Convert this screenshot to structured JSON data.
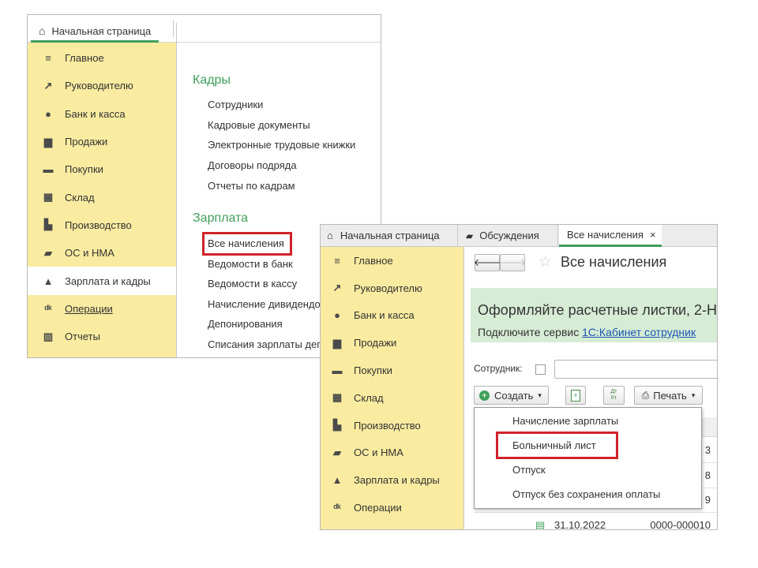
{
  "back_window": {
    "home_tab": "Начальная страница",
    "sidebar": [
      {
        "label": "Главное",
        "icon": "menu-icon"
      },
      {
        "label": "Руководителю",
        "icon": "trend-icon"
      },
      {
        "label": "Банк и касса",
        "icon": "coin-icon"
      },
      {
        "label": "Продажи",
        "icon": "bag-icon"
      },
      {
        "label": "Покупки",
        "icon": "cart-icon"
      },
      {
        "label": "Склад",
        "icon": "warehouse-icon"
      },
      {
        "label": "Производство",
        "icon": "factory-icon"
      },
      {
        "label": "ОС и НМА",
        "icon": "truck-icon"
      },
      {
        "label": "Зарплата и кадры",
        "icon": "person-icon"
      },
      {
        "label": "Операции",
        "icon": "dt-kt-icon"
      },
      {
        "label": "Отчеты",
        "icon": "bar-chart-icon"
      }
    ],
    "section_kadry": "Кадры",
    "kadry_links": [
      "Сотрудники",
      "Кадровые документы",
      "Электронные трудовые книжки",
      "Договоры подряда",
      "Отчеты по кадрам"
    ],
    "section_zarplata": "Зарплата",
    "zarplata_links": [
      "Все начисления",
      "Ведомости в банк",
      "Ведомости в кассу",
      "Начисление дивидендов",
      "Депонирования",
      "Списания зарплаты депонентов"
    ]
  },
  "front_window": {
    "tabs": {
      "home": "Начальная страница",
      "discussions": "Обсуждения",
      "all_accruals": "Все начисления",
      "close": "×"
    },
    "sidebar": [
      {
        "label": "Главное",
        "icon": "menu-icon"
      },
      {
        "label": "Руководителю",
        "icon": "trend-icon"
      },
      {
        "label": "Банк и касса",
        "icon": "coin-icon"
      },
      {
        "label": "Продажи",
        "icon": "bag-icon"
      },
      {
        "label": "Покупки",
        "icon": "cart-icon"
      },
      {
        "label": "Склад",
        "icon": "warehouse-icon"
      },
      {
        "label": "Производство",
        "icon": "factory-icon"
      },
      {
        "label": "ОС и НМА",
        "icon": "truck-icon"
      },
      {
        "label": "Зарплата и кадры",
        "icon": "person-icon"
      },
      {
        "label": "Операции",
        "icon": "dt-kt-icon"
      }
    ],
    "page_title": "Все начисления",
    "banner": {
      "title": "Оформляйте расчетные листки, 2-Н",
      "text": "Подключите сервис ",
      "link": "1С:Кабинет сотрудник"
    },
    "filter_label": "Сотрудник:",
    "toolbar": {
      "create": "Создать",
      "print": "Печать",
      "dt_kt": "Дт Кт"
    },
    "dropdown": [
      "Начисление зарплаты",
      "Больничный лист",
      "Отпуск",
      "Отпуск без сохранения оплаты"
    ],
    "rows": [
      {
        "date": "",
        "number": "3"
      },
      {
        "date": "",
        "number": "8"
      },
      {
        "date": "",
        "number": "9"
      },
      {
        "date": "31.10.2022",
        "number": "0000-000010"
      }
    ]
  }
}
